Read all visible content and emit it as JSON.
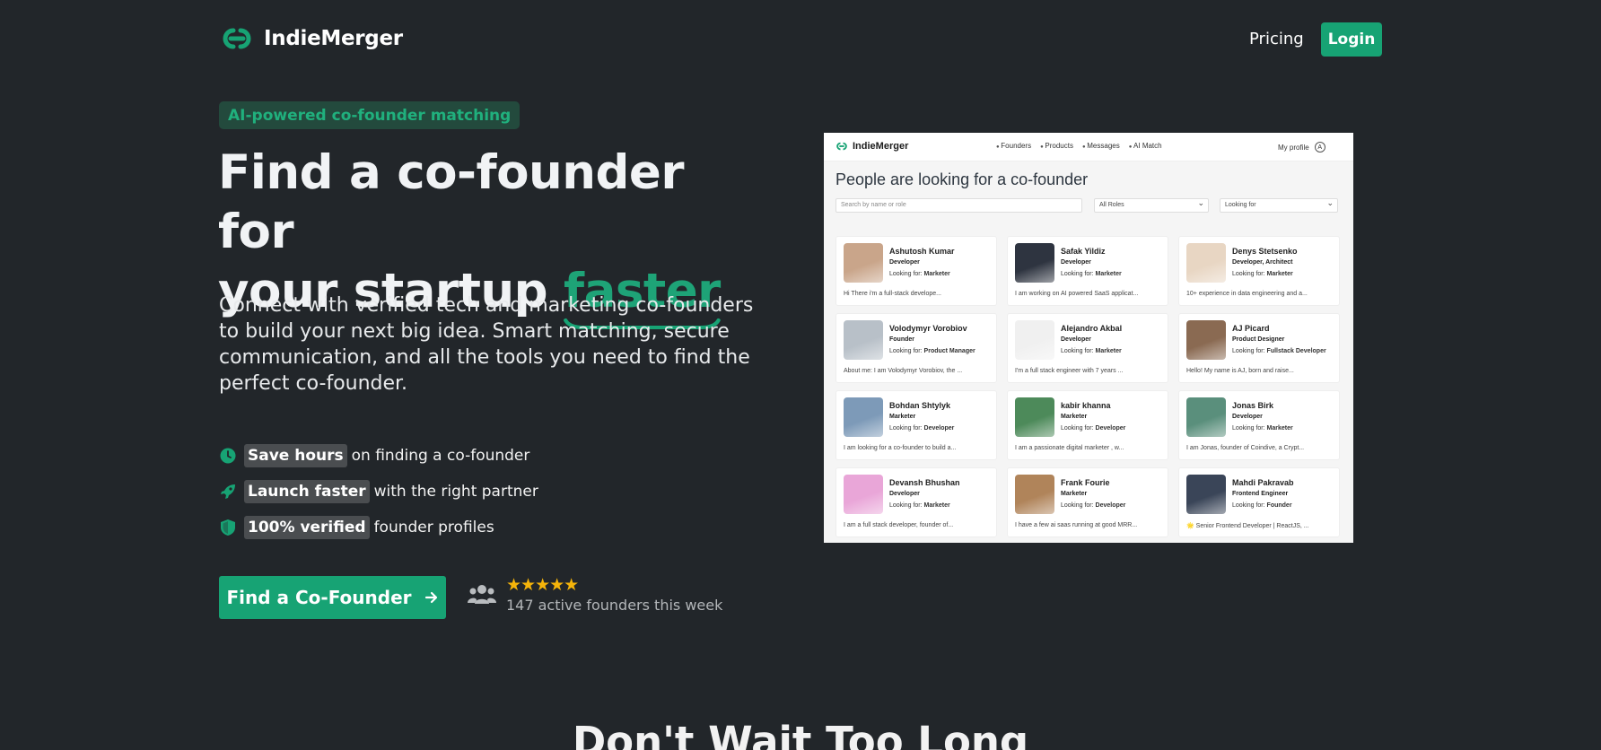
{
  "brand": {
    "name": "IndieMerger",
    "accent": "#17a374"
  },
  "nav": {
    "pricing": "Pricing",
    "login": "Login"
  },
  "hero": {
    "badge": "AI-powered co-founder matching",
    "title_line1": "Find a co-founder for",
    "title_line2": "your startup",
    "title_accent": "faster",
    "subtitle": "Connect with verified tech and marketing co-founders to build your next big idea. Smart matching, secure communication, and all the tools you need to find the perfect co-founder.",
    "features": [
      {
        "icon": "clock-icon",
        "highlight": "Save hours",
        "text": "on finding a co-founder"
      },
      {
        "icon": "rocket-icon",
        "highlight": "Launch faster",
        "text": "with the right partner"
      },
      {
        "icon": "shield-icon",
        "highlight": "100% verified",
        "text": "founder profiles"
      }
    ],
    "cta": "Find a Co-Founder",
    "stars": "★★★★★",
    "social_proof": "147 active founders this week"
  },
  "section": {
    "heading": "Don't Wait Too Long"
  },
  "screenshot": {
    "logo": "IndieMerger",
    "menu": [
      "Founders",
      "Products",
      "Messages",
      "AI Match"
    ],
    "profile": "My profile",
    "avatar_letter": "A",
    "title": "People are looking for a co-founder",
    "search_placeholder": "Search by name or role",
    "filter_roles": "All Roles",
    "filter_looking": "Looking for",
    "looking_label": "Looking for:",
    "cards": [
      {
        "name": "Ashutosh Kumar",
        "role": "Developer",
        "looking": "Marketer",
        "bio": "Hi There i'm a full-stack develope...",
        "color": "#c9a58a"
      },
      {
        "name": "Safak Yildiz",
        "role": "Developer",
        "looking": "Marketer",
        "bio": "I am working on AI powered SaaS applicat...",
        "color": "#2e3440"
      },
      {
        "name": "Denys Stetsenko",
        "role": "Developer, Architect",
        "looking": "Marketer",
        "bio": "10+ experience in data engineering and a...",
        "color": "#e8d6c3"
      },
      {
        "name": "Volodymyr Vorobiov",
        "role": "Founder",
        "looking": "Product Manager",
        "bio": "About me: I am Volodymyr Vorobiov, the ...",
        "color": "#b8c0c8"
      },
      {
        "name": "Alejandro Akbal",
        "role": "Developer",
        "looking": "Marketer",
        "bio": "I'm a full stack engineer with 7 years ...",
        "color": "#f0f0f0"
      },
      {
        "name": "AJ Picard",
        "role": "Product Designer",
        "looking": "Fullstack Developer",
        "bio": "Hello! My name is AJ, born and raise...",
        "color": "#8a6a52"
      },
      {
        "name": "Bohdan Shtylyk",
        "role": "Marketer",
        "looking": "Developer",
        "bio": "I am looking for a co-founder to build a...",
        "color": "#7d9ab8"
      },
      {
        "name": "kabir khanna",
        "role": "Marketer",
        "looking": "Developer",
        "bio": "I am a passionate digital marketer , w...",
        "color": "#4d8a5a"
      },
      {
        "name": "Jonas Birk",
        "role": "Developer",
        "looking": "Marketer",
        "bio": "I am Jonas, founder of Coindive, a Crypt...",
        "color": "#5a8f7c"
      },
      {
        "name": "Devansh Bhushan",
        "role": "Developer",
        "looking": "Marketer",
        "bio": "I am a full stack developer, founder of...",
        "color": "#e9a6d8"
      },
      {
        "name": "Frank Fourie",
        "role": "Marketer",
        "looking": "Developer",
        "bio": "I have a few ai saas running at good MRR...",
        "color": "#b0845a"
      },
      {
        "name": "Mahdi Pakravab",
        "role": "Frontend Engineer",
        "looking": "Founder",
        "bio": "🌟 Senior Frontend Developer | ReactJS, ...",
        "color": "#3a4558"
      }
    ]
  }
}
